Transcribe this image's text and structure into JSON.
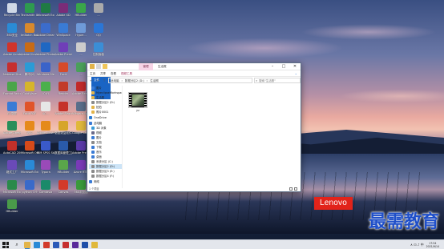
{
  "desktop": {
    "icons": [
      {
        "label": "Recycle Bin",
        "color": "#cfd8e6"
      },
      {
        "label": "Techsmith Camtasia",
        "color": "#2e9a4f"
      },
      {
        "label": "Microsoft Excel",
        "color": "#1f7a44"
      },
      {
        "label": "Adobe XD",
        "color": "#7a2c78"
      },
      {
        "label": "HBuilder",
        "color": "#3aa64a"
      },
      {
        "label": "...",
        "color": "#aaaaaa"
      },
      {
        "label": "360安全",
        "color": "#2a8bd6"
      },
      {
        "label": "ImBatch Batch",
        "color": "#d9892c"
      },
      {
        "label": "Adobe Dreamweaver",
        "color": "#3b6ccc"
      },
      {
        "label": "WinSpace",
        "color": "#3a7bd5"
      },
      {
        "label": "Hyper...",
        "color": "#6e9ad8"
      },
      {
        "label": "QQ",
        "color": "#2b76d6"
      },
      {
        "label": "Adobe Acrobat",
        "color": "#d0342c"
      },
      {
        "label": "Adobe Illustrator",
        "color": "#c86b16"
      },
      {
        "label": "Adobe Photoshop",
        "color": "#1f67c2"
      },
      {
        "label": "Adobe Premiere",
        "color": "#6f3fb8"
      },
      {
        "label": "...",
        "color": "#cccccc"
      },
      {
        "label": "控制面板",
        "color": "#3b8ed6"
      },
      {
        "label": "Netease Music",
        "color": "#c62f2f"
      },
      {
        "label": "腾讯QQ",
        "color": "#2a9bd6"
      },
      {
        "label": "Windows Media",
        "color": "#3a63c9"
      },
      {
        "label": "Foxit",
        "color": "#d64a2a"
      },
      {
        "label": "...",
        "color": "#4aa05a"
      },
      {
        "label": "Foxmail",
        "color": "#2e62c8"
      },
      {
        "label": "Format Factory",
        "color": "#4aa54a"
      },
      {
        "label": "GoldWave",
        "color": "#d6b52a"
      },
      {
        "label": "iQIYI",
        "color": "#4bb04b"
      },
      {
        "label": "Reader",
        "color": "#c23a2a"
      },
      {
        "label": "Adobe Reader",
        "color": "#c22a2a"
      },
      {
        "label": "Adobe",
        "color": "#d65a2a"
      },
      {
        "label": "EV录屏",
        "color": "#3a7bd5"
      },
      {
        "label": "Foxit PDF",
        "color": "#e0542a"
      },
      {
        "label": "AC...",
        "color": "#e6e6e6"
      },
      {
        "label": "Adobe Flash",
        "color": "#c5322a"
      },
      {
        "label": "VMware Workstation",
        "color": "#5a6e8a"
      },
      {
        "label": "eclipse",
        "color": "#2c2255"
      },
      {
        "label": "Adobe Dreamweaver",
        "color": "#2a8f5a"
      },
      {
        "label": "VLC",
        "color": "#e68a1a"
      },
      {
        "label": "Adobe Illustrator",
        "color": "#e58a1a"
      },
      {
        "label": "数据恢复软件",
        "color": "#d6a52a"
      },
      {
        "label": "Google Chrome",
        "color": "#e0b83a"
      },
      {
        "label": "FlashFXP",
        "color": "#c53a3a"
      },
      {
        "label": "AutoCAD 2008",
        "color": "#c2302a"
      },
      {
        "label": "Microsoft Office",
        "color": "#d64a1a"
      },
      {
        "label": "IBM SPSS Statistics",
        "color": "#3a5ac9"
      },
      {
        "label": "数据库管理工具",
        "color": "#2a5aa9"
      },
      {
        "label": "Adobe Premiere",
        "color": "#5a3aa9"
      },
      {
        "label": "TeraCopy",
        "color": "#3a9ad6"
      },
      {
        "label": "格式工厂",
        "color": "#6a4ab8"
      },
      {
        "label": "Microsoft Edge",
        "color": "#2a8ad6"
      },
      {
        "label": "Typora",
        "color": "#9a4ab8"
      },
      {
        "label": "HBuilder",
        "color": "#5aa54a"
      },
      {
        "label": "Azure RTM",
        "color": "#7a3ab8"
      },
      {
        "label": "360压缩",
        "color": "#c2a22a"
      },
      {
        "label": "Microsoft Excel",
        "color": "#2a8a4a"
      },
      {
        "label": "python 3.9",
        "color": "#3a6ac9"
      },
      {
        "label": "Camtasia",
        "color": "#1a8a6a"
      },
      {
        "label": "Canvas",
        "color": "#d23a2a"
      },
      {
        "label": "360浏览器",
        "color": "#3a9a3a"
      },
      {
        "label": "Microsoft PowerPoint",
        "color": "#c24a2a"
      },
      {
        "label": "HBuilder",
        "color": "#4a9a4a"
      }
    ],
    "brand": "Lenovo",
    "watermark": "最需教育"
  },
  "window": {
    "manage_tab": "管理",
    "title": "生活照",
    "min": "–",
    "max": "□",
    "close": "✕",
    "ribbon_tabs": [
      "文件",
      "主页",
      "共享",
      "查看",
      "视频工具"
    ],
    "ribbon_toggle": "⌄",
    "back": "←",
    "forward": "→",
    "up": "↑",
    "address": [
      "此电脑",
      "数据分区2 (D:)",
      "生活照"
    ],
    "address_sep": "›",
    "search_placeholder": "搜索\"生活照\"",
    "nav": [
      {
        "label": "图片",
        "color": "#3a7bd5",
        "group": false
      },
      {
        "label": "MyeclipseWorkspaces",
        "color": "#e2b44a",
        "group": false
      },
      {
        "label": "生活照",
        "color": "#e2b44a",
        "group": false
      },
      {
        "label": "数据分区2 (D:)",
        "color": "#8a8a8a",
        "group": false
      },
      {
        "label": "拍拍",
        "color": "#e2b44a",
        "group": false
      },
      {
        "label": "照片0001",
        "color": "#e2b44a",
        "group": false
      },
      {
        "label": "OneDrive",
        "color": "#2a7bd5",
        "group": true
      },
      {
        "label": "此电脑",
        "color": "#3a7bd5",
        "group": true
      },
      {
        "label": "3D 对象",
        "color": "#3a9ad6",
        "group": false
      },
      {
        "label": "视频",
        "color": "#6a6a8a",
        "group": false
      },
      {
        "label": "图片",
        "color": "#3a7bd5",
        "group": false
      },
      {
        "label": "文档",
        "color": "#8a8a8a",
        "group": false
      },
      {
        "label": "下载",
        "color": "#3a7bd5",
        "group": false
      },
      {
        "label": "音乐",
        "color": "#3a7bd5",
        "group": false
      },
      {
        "label": "桌面",
        "color": "#3a7bd5",
        "group": false
      },
      {
        "label": "系统分区 (C:)",
        "color": "#8a8a8a",
        "group": false
      },
      {
        "label": "数据分区2 (D:)",
        "color": "#8a8a8a",
        "group": false
      },
      {
        "label": "数据分区3 (E:)",
        "color": "#8a8a8a",
        "group": false
      },
      {
        "label": "数据分区4 (F:)",
        "color": "#8a8a8a",
        "group": false
      },
      {
        "label": "网络",
        "color": "#3a7bd5",
        "group": true
      }
    ],
    "file_name": "yz",
    "status": "1 个项目"
  },
  "taskbar": {
    "search": "⌕",
    "pins": [
      {
        "name": "file-explorer",
        "color": "#e2b44a",
        "active": true
      },
      {
        "name": "edge",
        "color": "#2a8ad6",
        "active": false
      },
      {
        "name": "wps",
        "color": "#d23a2a",
        "active": false
      },
      {
        "name": "word",
        "color": "#2a5ab8",
        "active": false
      },
      {
        "name": "netease-music",
        "color": "#c62f2f",
        "active": false
      },
      {
        "name": "premiere",
        "color": "#5a2a9a",
        "active": false
      },
      {
        "name": "photoshop",
        "color": "#1f4fa8",
        "active": false
      },
      {
        "name": "chrome",
        "color": "#e0b83a",
        "active": false
      }
    ],
    "tray_icons": "∧  ⊡  ♪  中",
    "time": "17:54",
    "date": "2021/9/14"
  }
}
